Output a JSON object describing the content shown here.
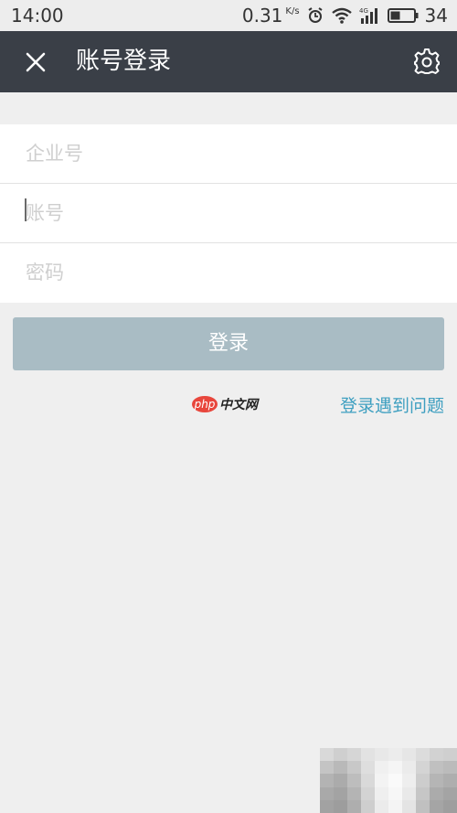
{
  "status_bar": {
    "time": "14:00",
    "net_speed": "0.31",
    "speed_unit": "K/s",
    "battery_level": "34",
    "icons": [
      "alarm-icon",
      "wifi-icon",
      "signal-4g-icon",
      "battery-icon"
    ]
  },
  "header": {
    "title": "账号登录",
    "close_icon": "close-icon",
    "settings_icon": "gear-icon"
  },
  "form": {
    "company_placeholder": "企业号",
    "account_placeholder": "账号",
    "password_placeholder": "密码",
    "company_value": "",
    "account_value": "",
    "password_value": ""
  },
  "actions": {
    "login_label": "登录",
    "help_link": "登录遇到问题"
  },
  "watermark": {
    "brand": "php",
    "brand_cn": "中文网"
  },
  "colors": {
    "title_bar": "#3a3f47",
    "login_button_disabled": "#a9bcc4",
    "link": "#3e9fc0",
    "background": "#efefef"
  }
}
